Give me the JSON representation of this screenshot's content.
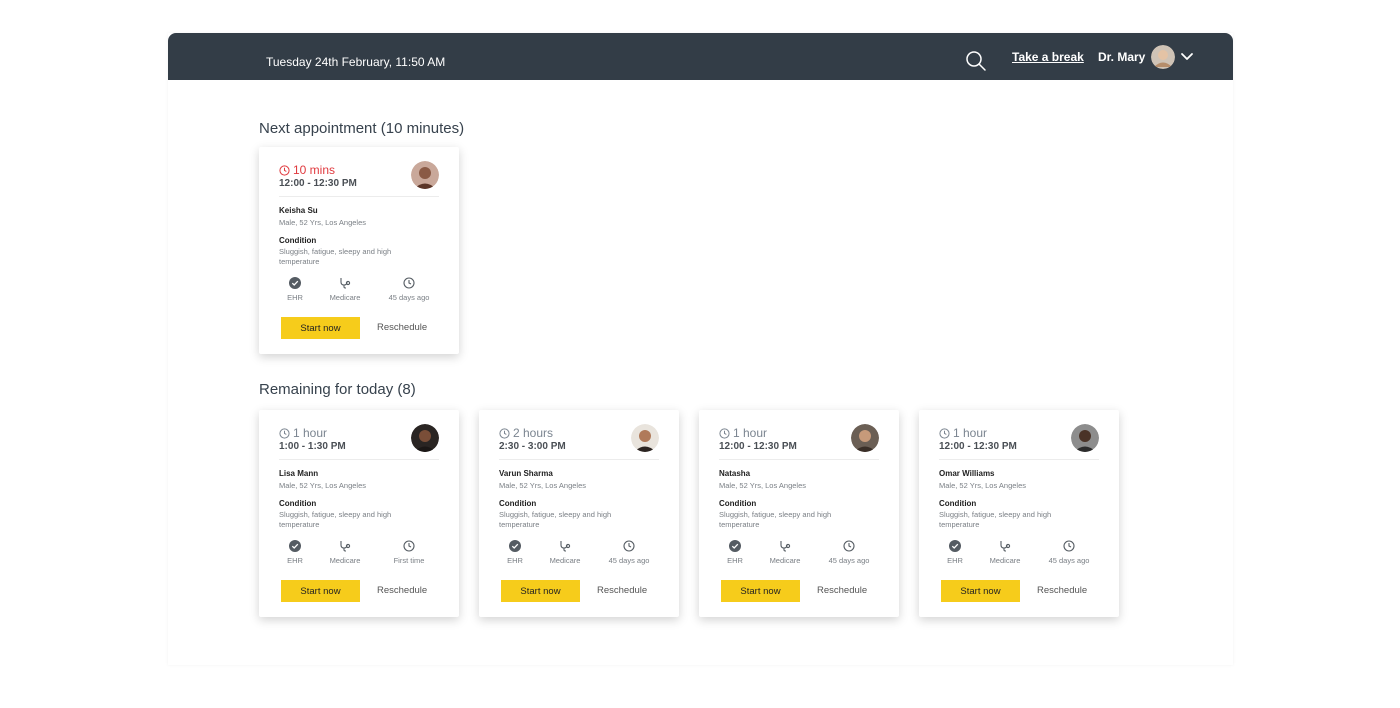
{
  "header": {
    "datetime": "Tuesday 24th February, 11:50 AM",
    "take_break": "Take a break",
    "user_name": "Dr. Mary"
  },
  "next_section": {
    "title": "Next appointment (10 minutes)"
  },
  "remaining_section": {
    "title": "Remaining for today (8)"
  },
  "labels": {
    "condition": "Condition",
    "ehr": "EHR",
    "medicare": "Medicare",
    "start": "Start now",
    "reschedule": "Reschedule"
  },
  "colors": {
    "header_bg": "#333d47",
    "accent": "#f6cc1b",
    "urgent": "#e0393e"
  },
  "appointments": [
    {
      "time_left": "10 mins",
      "slot": "12:00 - 12:30 PM",
      "name": "Keisha Su",
      "info": "Male, 52 Yrs, Los Angeles",
      "condition": "Sluggish, fatigue, sleepy and high temperature",
      "last_visit": "45 days ago",
      "urgent": true
    },
    {
      "time_left": "1 hour",
      "slot": "1:00 - 1:30 PM",
      "name": "Lisa Mann",
      "info": "Male, 52 Yrs, Los Angeles",
      "condition": "Sluggish, fatigue, sleepy and high temperature",
      "last_visit": "First time"
    },
    {
      "time_left": "2 hours",
      "slot": "2:30 - 3:00 PM",
      "name": "Varun Sharma",
      "info": "Male, 52 Yrs, Los Angeles",
      "condition": "Sluggish, fatigue, sleepy and high temperature",
      "last_visit": "45 days ago"
    },
    {
      "time_left": "1 hour",
      "slot": "12:00 - 12:30 PM",
      "name": "Natasha",
      "info": "Male, 52 Yrs, Los Angeles",
      "condition": "Sluggish, fatigue, sleepy and high temperature",
      "last_visit": "45 days ago"
    },
    {
      "time_left": "1 hour",
      "slot": "12:00 - 12:30 PM",
      "name": "Omar Williams",
      "info": "Male, 52 Yrs, Los Angeles",
      "condition": "Sluggish, fatigue, sleepy and high temperature",
      "last_visit": "45 days ago"
    }
  ]
}
